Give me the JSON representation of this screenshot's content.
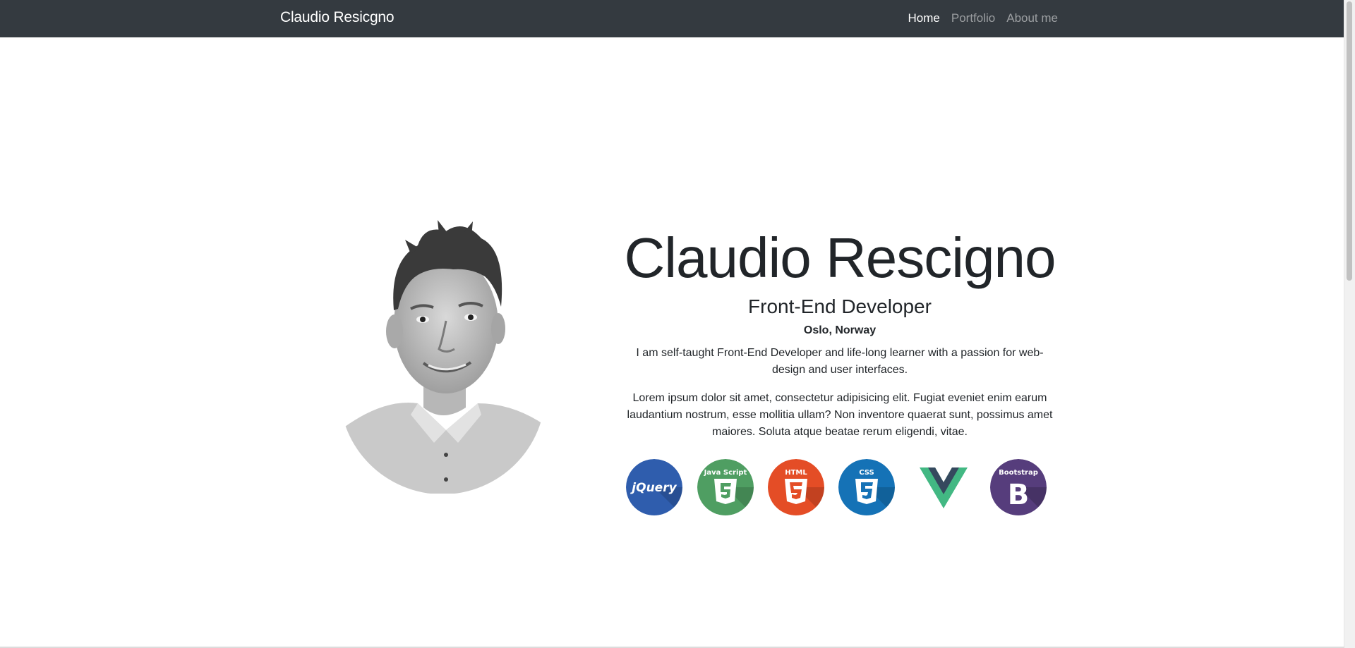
{
  "navbar": {
    "brand": "Claudio Resicgno",
    "links": [
      {
        "label": "Home",
        "active": true
      },
      {
        "label": "Portfolio",
        "active": false
      },
      {
        "label": "About me",
        "active": false
      }
    ]
  },
  "hero": {
    "name": "Claudio Rescigno",
    "role": "Front-End Developer",
    "location": "Oslo, Norway",
    "intro": "I am self-taught Front-End Developer and life-long learner with a passion for web-design and user interfaces.",
    "body": "Lorem ipsum dolor sit amet, consectetur adipisicing elit. Fugiat eveniet enim earum laudantium nostrum, esse mollitia ullam? Non inventore quaerat sunt, possimus amet maiores. Soluta atque beatae rerum eligendi, vitae."
  },
  "technologies": [
    {
      "name": "jquery-icon",
      "label": "jQuery",
      "color": "#2f5dad"
    },
    {
      "name": "javascript-icon",
      "label": "Java Script",
      "color": "#4f9e62"
    },
    {
      "name": "html5-icon",
      "label": "HTML",
      "color": "#e44d26"
    },
    {
      "name": "css3-icon",
      "label": "CSS",
      "color": "#1572b6"
    },
    {
      "name": "vue-icon",
      "label": "",
      "color": "#42b883"
    },
    {
      "name": "bootstrap-icon",
      "label": "Bootstrap",
      "color": "#563d7c"
    }
  ],
  "colors": {
    "navbar_bg": "#343a40",
    "text": "#212529"
  }
}
